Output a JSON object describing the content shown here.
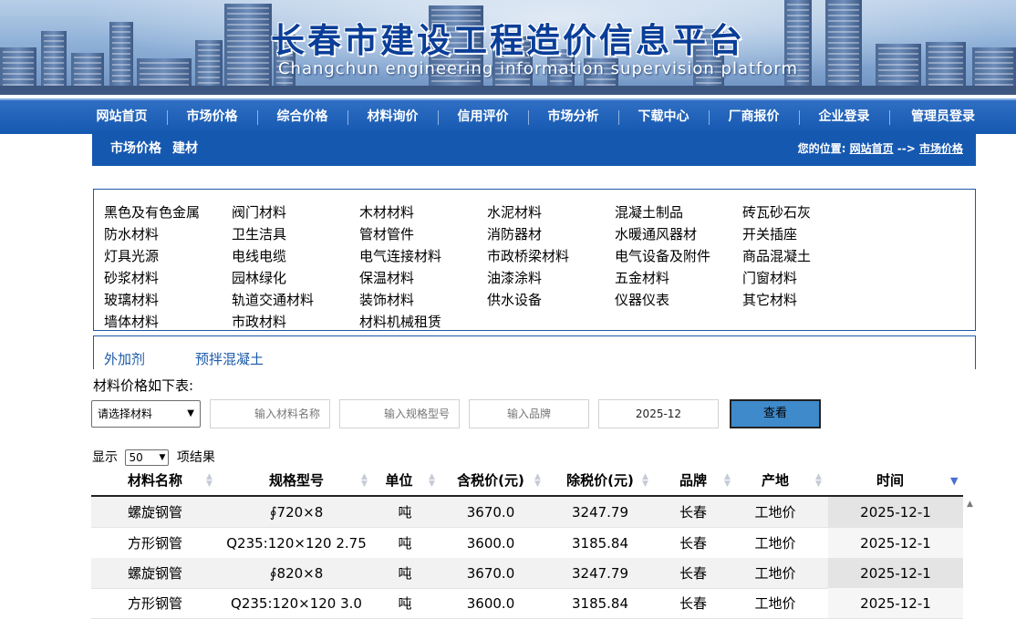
{
  "banner": {
    "title": "长春市建设工程造价信息平台",
    "subtitle": "Changchun engineering information supervision platform"
  },
  "nav": [
    "网站首页",
    "市场价格",
    "综合价格",
    "材料询价",
    "信用评价",
    "市场分析",
    "下载中心",
    "厂商报价",
    "企业登录",
    "管理员登录"
  ],
  "subhead": {
    "title1": "市场价格",
    "title2": "建材",
    "crumb_prefix": "您的位置:",
    "crumb_home": "网站首页",
    "crumb_arrow": "-->",
    "crumb_current": "市场价格"
  },
  "categories": [
    [
      "黑色及有色金属",
      "阀门材料",
      "木材材料",
      "水泥材料",
      "混凝土制品",
      "砖瓦砂石灰"
    ],
    [
      "防水材料",
      "卫生洁具",
      "管材管件",
      "消防器材",
      "水暖通风器材",
      "开关插座"
    ],
    [
      "灯具光源",
      "电线电缆",
      "电气连接材料",
      "市政桥梁材料",
      "电气设备及附件",
      "商品混凝土"
    ],
    [
      "砂浆材料",
      "园林绿化",
      "保温材料",
      "油漆涂料",
      "五金材料",
      "门窗材料"
    ],
    [
      "玻璃材料",
      "轨道交通材料",
      "装饰材料",
      "供水设备",
      "仪器仪表",
      "其它材料"
    ],
    [
      "墙体材料",
      "市政材料",
      "材料机械租赁"
    ]
  ],
  "tabs": [
    "外加剂",
    "预拌混凝土"
  ],
  "search": {
    "caption": "材料价格如下表:",
    "material_select": "请选择材料",
    "name_placeholder": "输入材料名称",
    "spec_placeholder": "输入规格型号",
    "brand_placeholder": "输入品牌",
    "date_value": "2025-12",
    "button": "查看"
  },
  "table": {
    "length_prefix": "显示",
    "length_value": "50",
    "length_suffix": "项结果",
    "columns": [
      "材料名称",
      "规格型号",
      "单位",
      "含税价(元)",
      "除税价(元)",
      "品牌",
      "产地",
      "时间"
    ],
    "rows": [
      [
        "螺旋钢管",
        "∮720×8",
        "吨",
        "3670.0",
        "3247.79",
        "长春",
        "工地价",
        "2025-12-1"
      ],
      [
        "方形钢管",
        "Q235:120×120 2.75",
        "吨",
        "3600.0",
        "3185.84",
        "长春",
        "工地价",
        "2025-12-1"
      ],
      [
        "螺旋钢管",
        "∮820×8",
        "吨",
        "3670.0",
        "3247.79",
        "长春",
        "工地价",
        "2025-12-1"
      ],
      [
        "方形钢管",
        "Q235:120×120 3.0",
        "吨",
        "3600.0",
        "3185.84",
        "长春",
        "工地价",
        "2025-12-1"
      ]
    ]
  },
  "icons": {
    "sort": "sort-both-icon",
    "sort_active": "sort-desc-icon",
    "dropdown": "chevron-down-icon",
    "scroll": "scroll-up-icon"
  },
  "colors": {
    "nav_blue": "#1558b0",
    "title_blue": "#0a3e98",
    "button_blue": "#3f8acb",
    "border_blue": "#1c5aa8"
  }
}
